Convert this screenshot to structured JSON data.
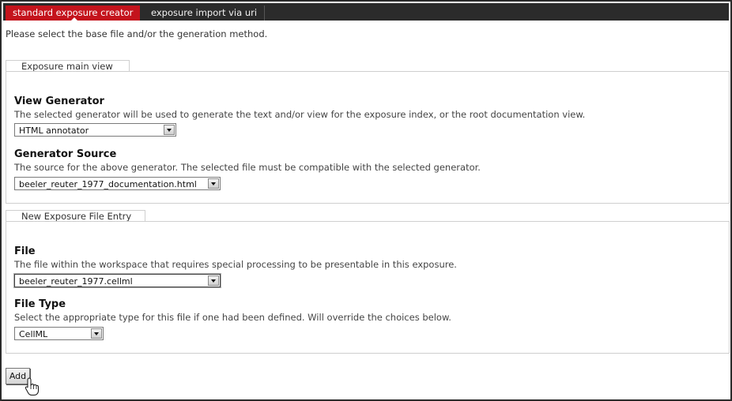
{
  "tabs": [
    {
      "label": "standard exposure creator",
      "active": true
    },
    {
      "label": "exposure import via uri",
      "active": false
    }
  ],
  "intro_text": "Please select the base file and/or the generation method.",
  "main_view": {
    "legend": "Exposure main view",
    "view_generator": {
      "label": "View Generator",
      "help": "The selected generator will be used to generate the text and/or view for the exposure index, or the root documentation view.",
      "value": "HTML annotator"
    },
    "generator_source": {
      "label": "Generator Source",
      "help": "The source for the above generator. The selected file must be compatible with the selected generator.",
      "value": "beeler_reuter_1977_documentation.html"
    }
  },
  "file_entry": {
    "legend": "New Exposure File Entry",
    "file": {
      "label": "File",
      "help": "The file within the workspace that requires special processing to be presentable in this exposure.",
      "value": "beeler_reuter_1977.cellml"
    },
    "file_type": {
      "label": "File Type",
      "help": "Select the appropriate type for this file if one had been defined. Will override the choices below.",
      "value": "CellML"
    }
  },
  "add_button_label": "Add",
  "colors": {
    "tab_active": "#c4131c",
    "tab_bar": "#2b2b2b"
  }
}
